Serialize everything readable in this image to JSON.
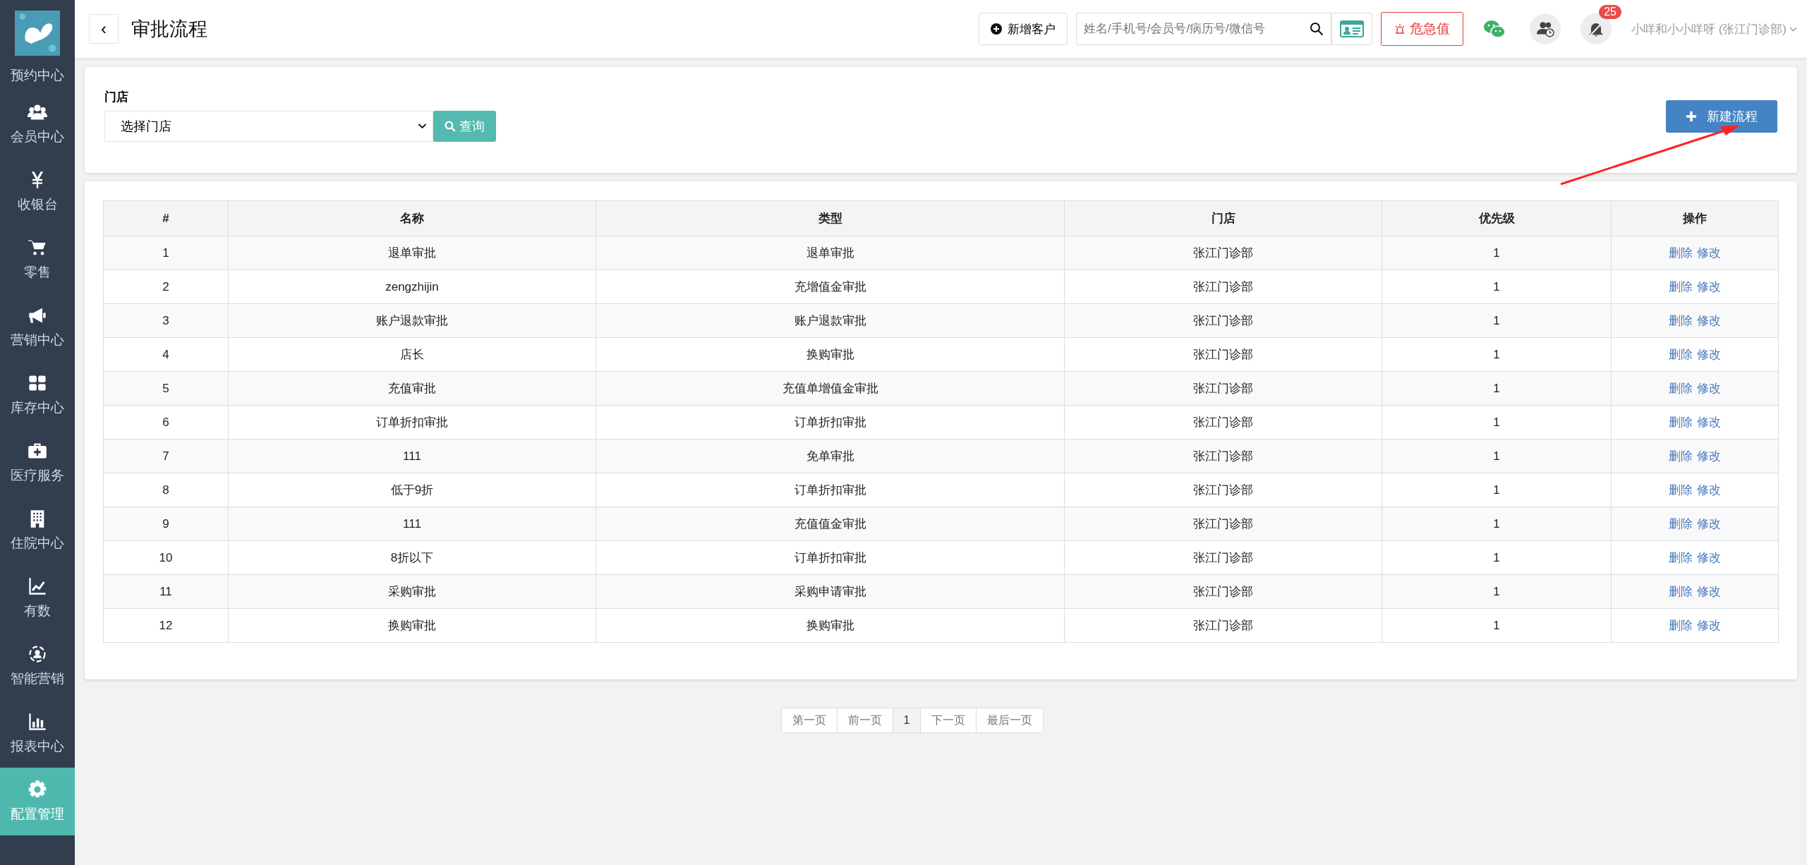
{
  "sidebar": {
    "items": [
      {
        "label": "预约中心",
        "selected": false
      },
      {
        "label": "会员中心",
        "selected": false
      },
      {
        "label": "收银台",
        "selected": false
      },
      {
        "label": "零售",
        "selected": false
      },
      {
        "label": "营销中心",
        "selected": false
      },
      {
        "label": "库存中心",
        "selected": false
      },
      {
        "label": "医疗服务",
        "selected": false
      },
      {
        "label": "住院中心",
        "selected": false
      },
      {
        "label": "有数",
        "selected": false
      },
      {
        "label": "智能营销",
        "selected": false
      },
      {
        "label": "报表中心",
        "selected": false
      },
      {
        "label": "配置管理",
        "selected": true
      }
    ]
  },
  "header": {
    "back": "‹",
    "title": "审批流程",
    "add_customer": "新增客户",
    "search": {
      "placeholder": "姓名/手机号/会员号/病历号/微信号"
    },
    "critical": "危急值",
    "notifications": "25",
    "user": "小咩和小小咩呀 (张江门诊部)"
  },
  "filter": {
    "label": "门店",
    "select": {
      "value": "选择门店"
    },
    "query": "查询",
    "new_flow": "新建流程"
  },
  "table": {
    "columns": [
      "#",
      "名称",
      "类型",
      "门店",
      "优先级",
      "操作"
    ],
    "rows": [
      {
        "no": "1",
        "name": "退单审批",
        "type": "退单审批",
        "store": "张江门诊部",
        "priority": "1",
        "actions": [
          "删除",
          "修改"
        ]
      },
      {
        "no": "2",
        "name": "zengzhijin",
        "type": "充增值金审批",
        "store": "张江门诊部",
        "priority": "1",
        "actions": [
          "删除",
          "修改"
        ]
      },
      {
        "no": "3",
        "name": "账户退款审批",
        "type": "账户退款审批",
        "store": "张江门诊部",
        "priority": "1",
        "actions": [
          "删除",
          "修改"
        ]
      },
      {
        "no": "4",
        "name": "店长",
        "type": "换购审批",
        "store": "张江门诊部",
        "priority": "1",
        "actions": [
          "删除",
          "修改"
        ]
      },
      {
        "no": "5",
        "name": "充值审批",
        "type": "充值单增值金审批",
        "store": "张江门诊部",
        "priority": "1",
        "actions": [
          "删除",
          "修改"
        ]
      },
      {
        "no": "6",
        "name": "订单折扣审批",
        "type": "订单折扣审批",
        "store": "张江门诊部",
        "priority": "1",
        "actions": [
          "删除",
          "修改"
        ]
      },
      {
        "no": "7",
        "name": "111",
        "type": "免单审批",
        "store": "张江门诊部",
        "priority": "1",
        "actions": [
          "删除",
          "修改"
        ]
      },
      {
        "no": "8",
        "name": "低于9折",
        "type": "订单折扣审批",
        "store": "张江门诊部",
        "priority": "1",
        "actions": [
          "删除",
          "修改"
        ]
      },
      {
        "no": "9",
        "name": "111",
        "type": "充值值金审批",
        "store": "张江门诊部",
        "priority": "1",
        "actions": [
          "删除",
          "修改"
        ]
      },
      {
        "no": "10",
        "name": "8折以下",
        "type": "订单折扣审批",
        "store": "张江门诊部",
        "priority": "1",
        "actions": [
          "删除",
          "修改"
        ]
      },
      {
        "no": "11",
        "name": "采购审批",
        "type": "采购申请审批",
        "store": "张江门诊部",
        "priority": "1",
        "actions": [
          "删除",
          "修改"
        ]
      },
      {
        "no": "12",
        "name": "换购审批",
        "type": "换购审批",
        "store": "张江门诊部",
        "priority": "1",
        "actions": [
          "删除",
          "修改"
        ]
      }
    ]
  },
  "pagination": [
    {
      "label": "第一页",
      "selected": false
    },
    {
      "label": "前一页",
      "selected": false
    },
    {
      "label": "1",
      "selected": true
    },
    {
      "label": "下一页",
      "selected": false
    },
    {
      "label": "最后一页",
      "selected": false
    }
  ]
}
